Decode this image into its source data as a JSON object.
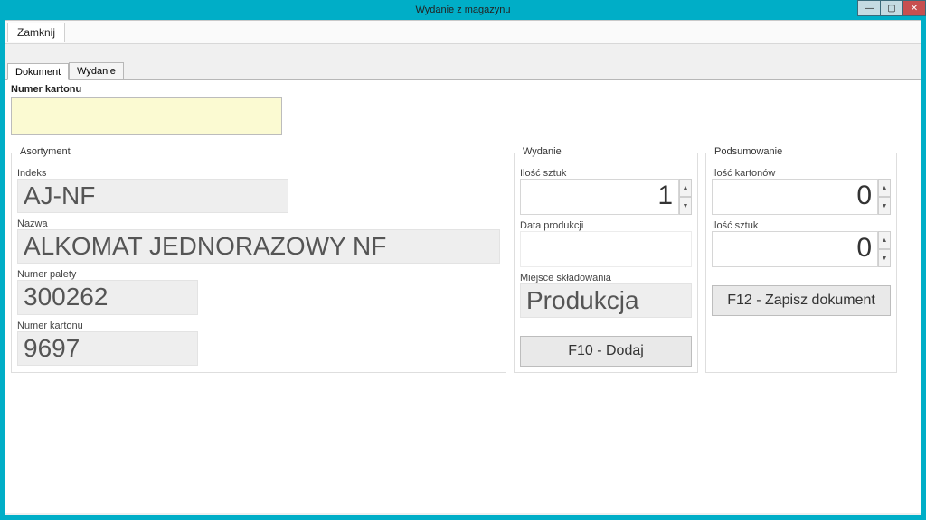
{
  "window": {
    "title": "Wydanie z magazynu"
  },
  "menu": {
    "close": "Zamknij"
  },
  "tabs": {
    "dokument": "Dokument",
    "wydanie": "Wydanie"
  },
  "topfield": {
    "label": "Numer kartonu",
    "value": ""
  },
  "asortyment": {
    "legend": "Asortyment",
    "indeks_label": "Indeks",
    "indeks": "AJ-NF",
    "nazwa_label": "Nazwa",
    "nazwa": "ALKOMAT JEDNORAZOWY NF",
    "paleta_label": "Numer palety",
    "paleta": "300262",
    "karton_label": "Numer kartonu",
    "karton": "9697"
  },
  "wydanie": {
    "legend": "Wydanie",
    "sztuk_label": "Ilość sztuk",
    "sztuk": "1",
    "data_label": "Data produkcji",
    "data": "",
    "miejsce_label": "Miejsce składowania",
    "miejsce": "Produkcja",
    "dodaj": "F10 - Dodaj"
  },
  "podsum": {
    "legend": "Podsumowanie",
    "kartonow_label": "Ilość kartonów",
    "kartonow": "0",
    "sztuk_label": "Ilość sztuk",
    "sztuk": "0",
    "zapisz": "F12 - Zapisz dokument"
  }
}
